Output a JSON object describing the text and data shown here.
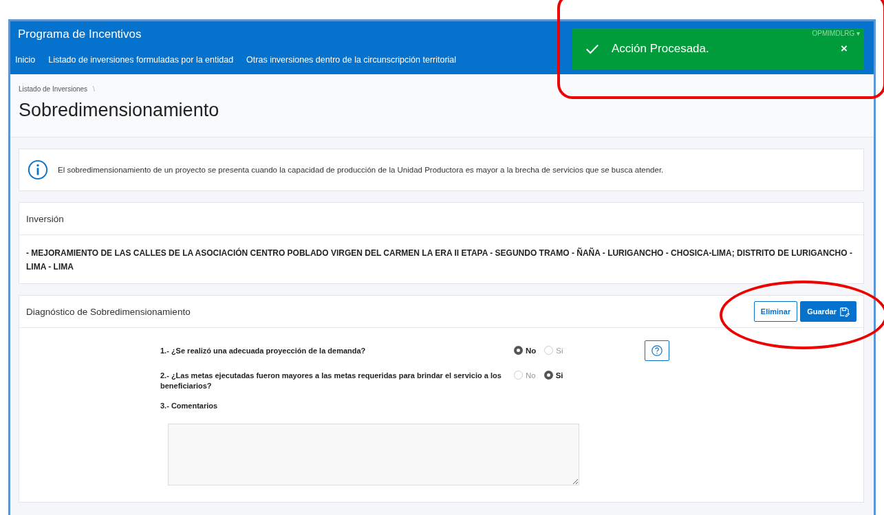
{
  "app": {
    "title": "Programa de Incentivos",
    "user": "OPMIMDLRG ▾"
  },
  "nav": [
    {
      "label": "Inicio"
    },
    {
      "label": "Listado de inversiones formuladas por la entidad"
    },
    {
      "label": "Otras inversiones dentro de la circunscripción territorial"
    }
  ],
  "toast": {
    "message": "Acción Procesada.",
    "close": "×"
  },
  "breadcrumb": {
    "items": [
      "Listado de Inversiones"
    ],
    "separator": "\\"
  },
  "page_title": "Sobredimensionamiento",
  "info": "El sobredimensionamiento de un proyecto se presenta cuando la capacidad de producción de la Unidad Productora es mayor a la brecha de servicios que se busca atender.",
  "investment": {
    "heading": "Inversión",
    "name": "- MEJORAMIENTO DE LAS CALLES DE LA ASOCIACIÓN CENTRO POBLADO VIRGEN DEL CARMEN LA ERA II ETAPA - SEGUNDO TRAMO - ÑAÑA - LURIGANCHO - CHOSICA-LIMA; DISTRITO DE LURIGANCHO - LIMA - LIMA"
  },
  "diagnosis": {
    "heading": "Diagnóstico de Sobredimensionamiento",
    "buttons": [
      {
        "label": "Eliminar",
        "kind": "secondary"
      },
      {
        "label": "Guardar",
        "kind": "primary"
      }
    ],
    "questions": [
      {
        "label": "1.- ¿Se realizó una adecuada proyección de la demanda?",
        "kind": "radio",
        "help": true,
        "options": [
          {
            "label": "No",
            "selected": true
          },
          {
            "label": "Si",
            "selected": false
          }
        ]
      },
      {
        "label": "2.- ¿Las metas ejecutadas fueron mayores a las metas requeridas para brindar el servicio a los beneficiarios?",
        "kind": "radio",
        "help": false,
        "options": [
          {
            "label": "No",
            "selected": false
          },
          {
            "label": "Si",
            "selected": true
          }
        ]
      },
      {
        "label": "3.- Comentarios",
        "kind": "textarea"
      }
    ]
  }
}
